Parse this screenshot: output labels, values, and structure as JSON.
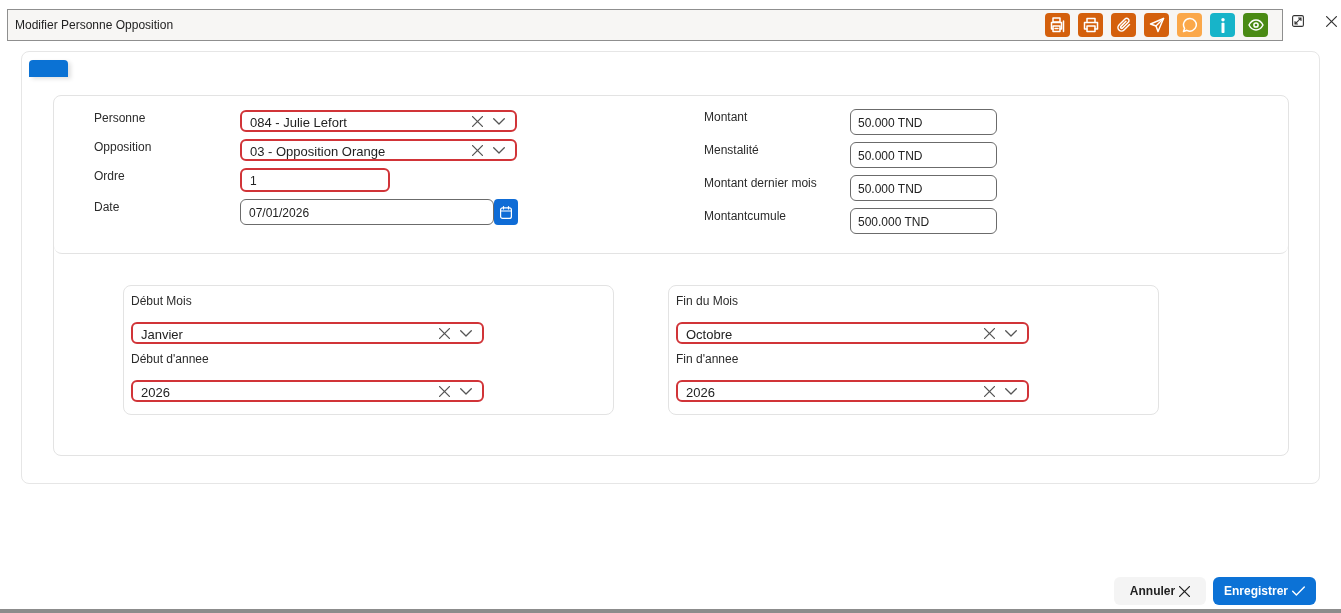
{
  "window": {
    "title": "Modifier Personne Opposition"
  },
  "toolbar": [
    {
      "kind": "fax",
      "color": "#d4600c"
    },
    {
      "kind": "print",
      "color": "#d4600c"
    },
    {
      "kind": "attach",
      "color": "#d4600c"
    },
    {
      "kind": "send",
      "color": "#d4600c"
    },
    {
      "kind": "chat",
      "color": "#fba84a"
    },
    {
      "kind": "info",
      "color": "#17b4c9"
    },
    {
      "kind": "view",
      "color": "#4a8a14"
    }
  ],
  "tabs": [
    {
      "selected": true
    }
  ],
  "form": {
    "left": [
      {
        "label": "Personne",
        "kind": "select",
        "value": "084 - Julie Lefort",
        "invalid": true
      },
      {
        "label": "Opposition",
        "kind": "select",
        "value": "03 - Opposition Orange",
        "invalid": true
      },
      {
        "label": "Ordre",
        "kind": "text",
        "value": "1",
        "invalid": true
      },
      {
        "label": "Date",
        "kind": "date",
        "value": "07/01/2026",
        "invalid": false
      }
    ],
    "right": [
      {
        "label": "Montant",
        "value": "50.000 TND"
      },
      {
        "label": "Menstalité",
        "value": "50.000 TND"
      },
      {
        "label": "Montant dernier mois",
        "value": "50.000 TND"
      },
      {
        "label": "Montantcumule",
        "value": "500.000 TND"
      }
    ]
  },
  "periods": [
    {
      "fields": [
        {
          "label": "Début Mois",
          "value": "Janvier",
          "invalid": true
        },
        {
          "label": "Début d'annee",
          "value": "2026",
          "invalid": true
        }
      ]
    },
    {
      "fields": [
        {
          "label": "Fin du Mois",
          "value": "Octobre",
          "invalid": true
        },
        {
          "label": "Fin d'annee",
          "value": "2026",
          "invalid": true
        }
      ]
    }
  ],
  "buttons": [
    {
      "kind": "cancel",
      "label": "Annuler"
    },
    {
      "kind": "save",
      "label": "Enregistrer"
    }
  ]
}
